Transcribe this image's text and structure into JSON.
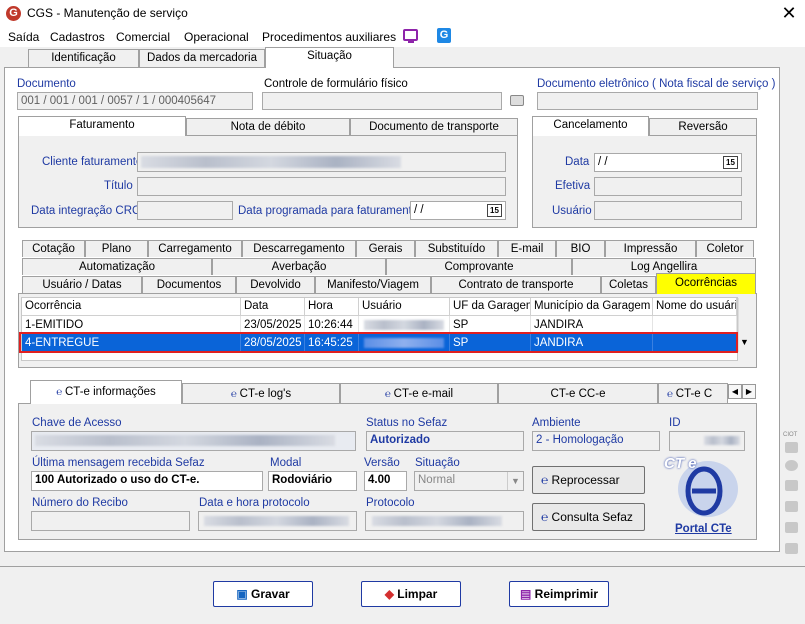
{
  "window": {
    "title": "CGS - Manutenção de serviço",
    "app_icon_letter": "G"
  },
  "menu": [
    "Saída",
    "Cadastros",
    "Comercial",
    "Operacional",
    "Procedimentos auxiliares"
  ],
  "top_tabs": [
    "Identificação",
    "Dados da mercadoria",
    "Situação"
  ],
  "documento": {
    "label": "Documento",
    "value": "001 / 001 / 001 / 0057 / 1 / 000405647",
    "controle_label": "Controle de formulário físico",
    "eletronico_label": "Documento eletrônico ( Nota fiscal de serviço )"
  },
  "fat_tabs": [
    "Faturamento",
    "Nota de débito",
    "Documento de transporte"
  ],
  "fat": {
    "cliente_label": "Cliente faturamento",
    "titulo_label": "Título",
    "crc_label": "Data integração CRC",
    "prog_label": "Data programada para faturamento",
    "prog_value": "/  /"
  },
  "canc_tabs": [
    "Cancelamento",
    "Reversão"
  ],
  "canc": {
    "data_label": "Data",
    "data_value": "/  /",
    "efetiva_label": "Efetiva",
    "usuario_label": "Usuário"
  },
  "calendar_glyph": "15",
  "mid_tabs_row1": [
    "Cotação",
    "Plano",
    "Carregamento",
    "Descarregamento",
    "Gerais",
    "Substituído",
    "E-mail",
    "BIO",
    "Impressão",
    "Coletor"
  ],
  "mid_tabs_row2": [
    "Automatização",
    "Averbação",
    "Comprovante",
    "Log Angellira"
  ],
  "mid_tabs_row3": [
    "Usuário / Datas",
    "Documentos",
    "Devolvido",
    "Manifesto/Viagem",
    "Contrato de transporte",
    "Coletas",
    "Ocorrências"
  ],
  "grid": {
    "headers": [
      "Ocorrência",
      "Data",
      "Hora",
      "Usuário",
      "UF da Garagem",
      "Município da Garagem",
      "Nome do usuário"
    ],
    "rows": [
      {
        "ocorrencia": "1-EMITIDO",
        "data": "23/05/2025",
        "hora": "10:26:44",
        "uf": "SP",
        "municipio": "JANDIRA"
      },
      {
        "ocorrencia": "4-ENTREGUE",
        "data": "28/05/2025",
        "hora": "16:45:25",
        "uf": "SP",
        "municipio": "JANDIRA"
      }
    ]
  },
  "cte_tabs": [
    "CT-e informações",
    "CT-e log's",
    "CT-e e-mail",
    "CT-e CC-e",
    "CT-e C"
  ],
  "cte": {
    "chave_label": "Chave de Acesso",
    "status_label": "Status no Sefaz",
    "status_value": "Autorizado",
    "ambiente_label": "Ambiente",
    "ambiente_value": "2 - Homologação",
    "id_label": "ID",
    "ultima_label": "Última mensagem recebida Sefaz",
    "ultima_value": "100 Autorizado o uso do CT-e.",
    "modal_label": "Modal",
    "modal_value": "Rodoviário",
    "versao_label": "Versão",
    "versao_value": "4.00",
    "situacao_label": "Situação",
    "situacao_value": "Normal",
    "recibo_label": "Número do Recibo",
    "data_protocolo_label": "Data e hora protocolo",
    "protocolo_label": "Protocolo",
    "reprocessar_label": "Reprocessar",
    "consulta_label": "Consulta Sefaz",
    "portal_label": "Portal CTe",
    "logo_text": "CT e"
  },
  "buttons": {
    "gravar": "Gravar",
    "limpar": "Limpar",
    "reimprimir": "Reimprimir"
  },
  "side_label": "CIOT",
  "colors": {
    "selection": "#0a64d8",
    "highlight_tab": "#ffff00",
    "label_blue": "#1f3aa3",
    "red_outline": "#e02020"
  }
}
